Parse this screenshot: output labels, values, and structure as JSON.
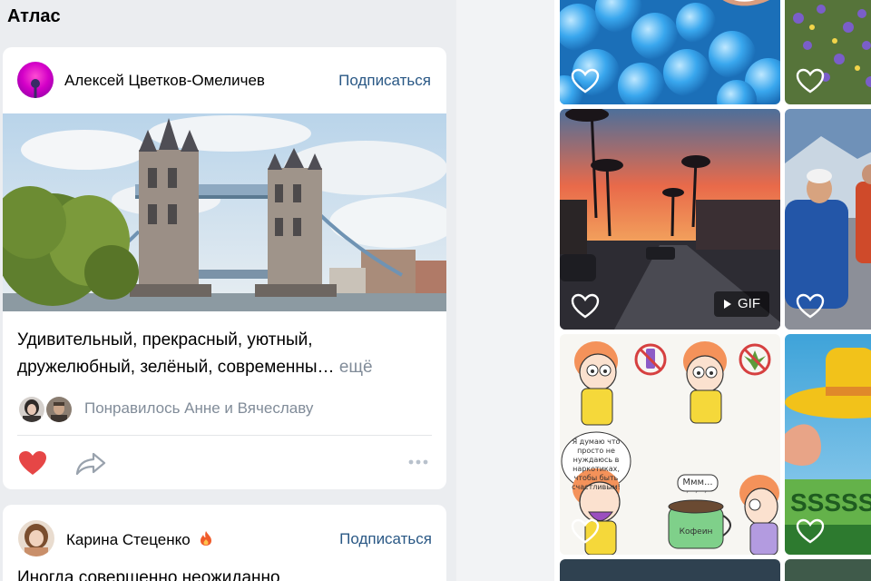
{
  "page": {
    "title": "Атлас"
  },
  "posts": [
    {
      "author": "Алексей Цветков-Омеличев",
      "subscribe_label": "Подписаться",
      "text": "Удивительный, прекрасный, уютный, дружелюбный, зелёный, современны…",
      "more_label": "ещё",
      "likes_text": "Понравилось Анне и Вячеславу"
    },
    {
      "author": "Карина Стеценко",
      "subscribe_label": "Подписаться",
      "text": "Иногда совершенно неожиданно"
    }
  ],
  "grid": {
    "gif_label": "GIF",
    "comic_caption": "Я думаю что просто не нуждаюсь в наркотиках, чтобы быть счастливым!",
    "comic_bubble": "Ммм...",
    "comic_cup": "Кофеин",
    "banner_text": "SSSSS"
  },
  "colors": {
    "accent": "#2a5885",
    "like_red": "#e64646",
    "muted": "#818c99"
  }
}
